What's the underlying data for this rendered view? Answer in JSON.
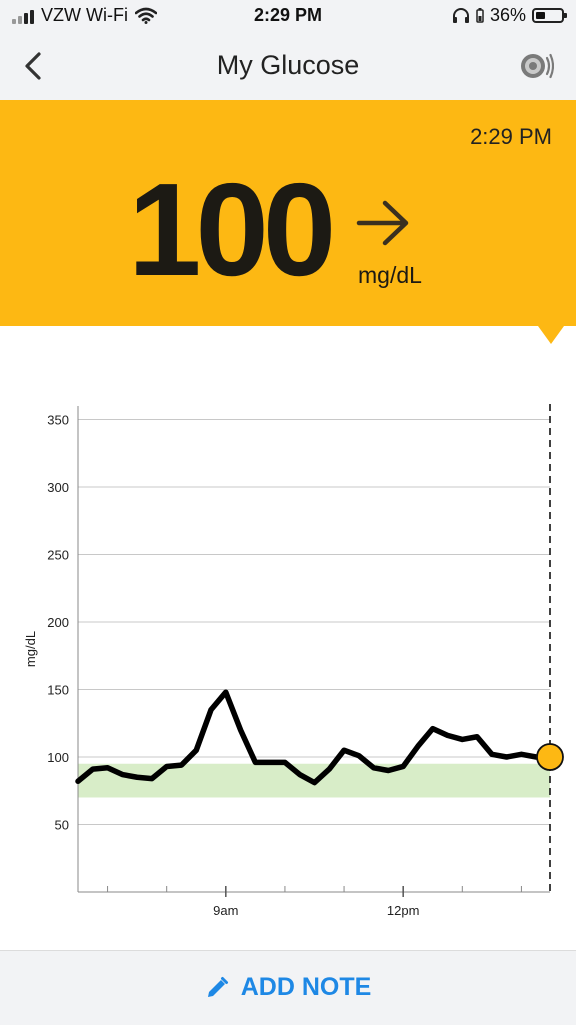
{
  "status_bar": {
    "carrier": "VZW Wi-Fi",
    "time": "2:29 PM",
    "battery": "36%"
  },
  "nav": {
    "title": "My Glucose"
  },
  "reading": {
    "time": "2:29 PM",
    "value": "100",
    "unit": "mg/dL",
    "trend": "steady"
  },
  "colors": {
    "banner": "#fdb813",
    "target_range": "#d8edc8",
    "accent": "#1e88e5",
    "current_point": "#fdb813"
  },
  "chart_data": {
    "type": "line",
    "ylabel": "mg/dL",
    "ylim": [
      0,
      360
    ],
    "y_ticks": [
      "350",
      "300",
      "250",
      "200",
      "150",
      "100",
      "50"
    ],
    "x_ticks": [
      "9am",
      "12pm"
    ],
    "target_range": [
      70,
      95
    ],
    "series": [
      {
        "x": [
          "6:30",
          "6:45",
          "7:00",
          "7:15",
          "7:30",
          "7:45",
          "8:00",
          "8:15",
          "8:30",
          "8:45",
          "9:00",
          "9:15",
          "9:30",
          "9:45",
          "10:00",
          "10:15",
          "10:30",
          "10:45",
          "11:00",
          "11:15",
          "11:30",
          "11:45",
          "12:00",
          "12:15",
          "12:30",
          "12:45",
          "13:00",
          "13:15",
          "13:30",
          "13:45",
          "14:00",
          "14:15",
          "14:29"
        ],
        "values": [
          82,
          91,
          92,
          87,
          85,
          84,
          93,
          94,
          105,
          135,
          148,
          120,
          96,
          96,
          96,
          87,
          81,
          91,
          105,
          101,
          92,
          90,
          93,
          108,
          121,
          116,
          113,
          115,
          102,
          100,
          102,
          100,
          100
        ]
      }
    ],
    "current": {
      "value": 100
    }
  },
  "footer": {
    "add_note_label": "ADD NOTE"
  }
}
